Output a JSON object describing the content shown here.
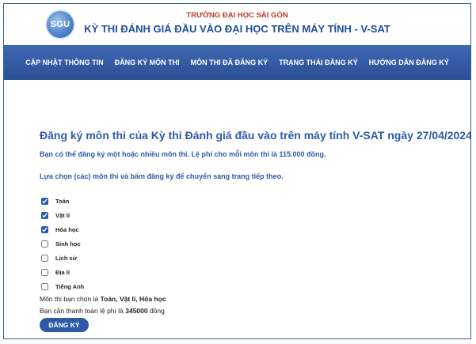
{
  "header": {
    "logo_text": "SGU",
    "university": "TRƯỜNG ĐẠI HỌC SÀI GÒN",
    "exam_title": "KỲ THI ĐÁNH GIÁ ĐẦU VÀO ĐẠI HỌC TRÊN MÁY TÍNH - V-SAT"
  },
  "nav": {
    "items": [
      "CẬP NHẬT THÔNG TIN",
      "ĐĂNG KÝ MÔN THI",
      "MÔN THI ĐÃ ĐĂNG KÝ",
      "TRẠNG THÁI ĐĂNG KÝ",
      "HƯỚNG DẪN ĐĂNG KÝ"
    ]
  },
  "main": {
    "title": "Đăng ký môn thi của Kỳ thi Đánh giá đầu vào trên máy tính V-SAT ngày 27/04/2024",
    "intro": "Bạn có thể đăng ký một hoặc nhiều môn thi. Lệ phí cho mỗi môn thi là 115.000 đồng.",
    "instruction": "Lựa chọn (các) môn thi và bấm đăng ký để chuyển sang trang tiếp theo.",
    "subjects": [
      {
        "label": "Toán",
        "checked": true
      },
      {
        "label": "Vật lí",
        "checked": true
      },
      {
        "label": "Hóa học",
        "checked": true
      },
      {
        "label": "Sinh học",
        "checked": false
      },
      {
        "label": "Lịch sử",
        "checked": false
      },
      {
        "label": "Địa lí",
        "checked": false
      },
      {
        "label": "Tiếng Anh",
        "checked": false
      }
    ],
    "selected_prefix": "Môn thi bạn chọn là ",
    "selected_value": "Toán, Vật lí, Hóa học",
    "selected_suffix": ".",
    "fee_prefix": "Bạn cần thanh toán lệ phí là ",
    "fee_value": "345000",
    "fee_suffix": " đồng",
    "submit_label": "ĐĂNG KÝ"
  },
  "colors": {
    "accent": "#2d5aa8",
    "nav_background": "#3a63ad",
    "university_text": "#c0392b"
  }
}
